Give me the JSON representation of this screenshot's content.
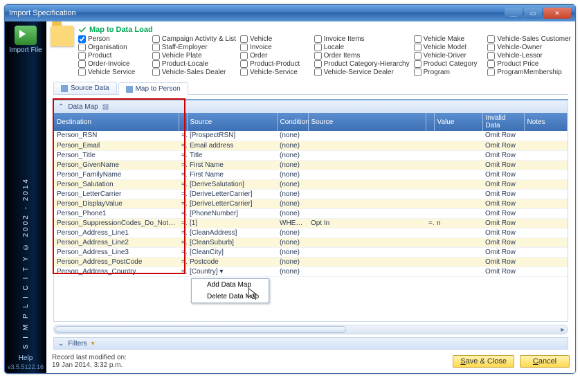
{
  "window": {
    "title": "Import Specification"
  },
  "sidebar": {
    "import_label": "Import File",
    "brand": "S I M P L I C I T Y  ©  2002 - 2014",
    "help": "Help",
    "version": "v3.5.5122.16"
  },
  "checkbox_section": {
    "title": "Map to Data Load",
    "items": [
      {
        "label": "Person",
        "checked": true
      },
      {
        "label": "Campaign Activity & List",
        "checked": false
      },
      {
        "label": "Vehicle",
        "checked": false
      },
      {
        "label": "Invoice Items",
        "checked": false
      },
      {
        "label": "Vehicle Make",
        "checked": false
      },
      {
        "label": "Vehicle-Sales Customer",
        "checked": false
      },
      {
        "label": "Organisation",
        "checked": false
      },
      {
        "label": "Staff-Employer",
        "checked": false
      },
      {
        "label": "Invoice",
        "checked": false
      },
      {
        "label": "Locale",
        "checked": false
      },
      {
        "label": "Vehicle Model",
        "checked": false
      },
      {
        "label": "Vehicle-Owner",
        "checked": false
      },
      {
        "label": "Product",
        "checked": false
      },
      {
        "label": "Vehicle Plate",
        "checked": false
      },
      {
        "label": "Order",
        "checked": false
      },
      {
        "label": "Order Items",
        "checked": false
      },
      {
        "label": "Vehicle-Driver",
        "checked": false
      },
      {
        "label": "Vehicle-Lessor",
        "checked": false
      },
      {
        "label": "Order-Invoice",
        "checked": false
      },
      {
        "label": "Product-Locale",
        "checked": false
      },
      {
        "label": "Product-Product",
        "checked": false
      },
      {
        "label": "Product Category-Hierarchy",
        "checked": false
      },
      {
        "label": "Product Category",
        "checked": false
      },
      {
        "label": "Product Price",
        "checked": false
      },
      {
        "label": "Vehicle Service",
        "checked": false
      },
      {
        "label": "Vehicle-Sales Dealer",
        "checked": false
      },
      {
        "label": "Vehicle-Service",
        "checked": false
      },
      {
        "label": "Vehicle-Service Dealer",
        "checked": false
      },
      {
        "label": "Program",
        "checked": false
      },
      {
        "label": "ProgramMembership",
        "checked": false
      }
    ]
  },
  "tabs": [
    {
      "label": "Source Data",
      "active": false
    },
    {
      "label": "Map to Person",
      "active": true
    }
  ],
  "grid": {
    "panel_title": "Data Map",
    "columns": [
      "Destination",
      "",
      "Source",
      "Condition",
      "Source",
      "",
      "Value",
      "Invalid Data",
      "Notes"
    ],
    "col_widths": [
      "180px",
      "12px",
      "130px",
      "45px",
      "170px",
      "12px",
      "70px",
      "60px",
      "auto"
    ],
    "rows": [
      {
        "dest": "Person_RSN",
        "op": "=",
        "src": "[ProspectRSN]",
        "cond": "(none)",
        "src2": "",
        "op2": "",
        "val": "",
        "inv": "Omit Row",
        "alt": false
      },
      {
        "dest": "Person_Email",
        "op": "=",
        "src": "Email address",
        "cond": "(none)",
        "src2": "",
        "op2": "",
        "val": "",
        "inv": "Omit Row",
        "alt": true
      },
      {
        "dest": "Person_Title",
        "op": "=",
        "src": "Title",
        "cond": "(none)",
        "src2": "",
        "op2": "",
        "val": "",
        "inv": "Omit Row",
        "alt": false
      },
      {
        "dest": "Person_GivenName",
        "op": "=",
        "src": "First Name",
        "cond": "(none)",
        "src2": "",
        "op2": "",
        "val": "",
        "inv": "Omit Row",
        "alt": true
      },
      {
        "dest": "Person_FamilyName",
        "op": "=",
        "src": "First Name",
        "cond": "(none)",
        "src2": "",
        "op2": "",
        "val": "",
        "inv": "Omit Row",
        "alt": false
      },
      {
        "dest": "Person_Salutation",
        "op": "=",
        "src": "[DeriveSalutation]",
        "cond": "(none)",
        "src2": "",
        "op2": "",
        "val": "",
        "inv": "Omit Row",
        "alt": true
      },
      {
        "dest": "Person_LetterCarrier",
        "op": "=",
        "src": "[DeriveLetterCarrier]",
        "cond": "(none)",
        "src2": "",
        "op2": "",
        "val": "",
        "inv": "Omit Row",
        "alt": false
      },
      {
        "dest": "Person_DisplayValue",
        "op": "=",
        "src": "[DeriveLetterCarrier]",
        "cond": "(none)",
        "src2": "",
        "op2": "",
        "val": "",
        "inv": "Omit Row",
        "alt": true
      },
      {
        "dest": "Person_Phone1",
        "op": "=",
        "src": "[PhoneNumber]",
        "cond": "(none)",
        "src2": "",
        "op2": "",
        "val": "",
        "inv": "Omit Row",
        "alt": false
      },
      {
        "dest": "Person_SuppressionCodes_Do_Not_Contact",
        "op": "=",
        "src": "[1]",
        "cond": "WHERE",
        "src2": "Opt In",
        "op2": "=",
        "val": "n",
        "inv": "Omit Row",
        "alt": true
      },
      {
        "dest": "Person_Address_Line1",
        "op": "=",
        "src": "[CleanAddress]",
        "cond": "(none)",
        "src2": "",
        "op2": "",
        "val": "",
        "inv": "Omit Row",
        "alt": false
      },
      {
        "dest": "Person_Address_Line2",
        "op": "=",
        "src": "[CleanSuburb]",
        "cond": "(none)",
        "src2": "",
        "op2": "",
        "val": "",
        "inv": "Omit Row",
        "alt": true
      },
      {
        "dest": "Person_Address_Line3",
        "op": "=",
        "src": "[CleanCity]",
        "cond": "(none)",
        "src2": "",
        "op2": "",
        "val": "",
        "inv": "Omit Row",
        "alt": false
      },
      {
        "dest": "Person_Address_PostCode",
        "op": "=",
        "src": "Postcode",
        "cond": "(none)",
        "src2": "",
        "op2": "",
        "val": "",
        "inv": "Omit Row",
        "alt": true
      },
      {
        "dest": "Person_Address_Country",
        "op": "=",
        "src": "[Country]",
        "cond": "(none)",
        "src2": "",
        "op2": "",
        "val": "",
        "inv": "Omit Row",
        "alt": false,
        "dropdown": true
      }
    ]
  },
  "context_menu": {
    "items": [
      "Add Data Map",
      "Delete Data Map"
    ]
  },
  "filters_label": "Filters",
  "footer": {
    "modified_label": "Record last modified on:",
    "modified_value": "19 Jan 2014, 3:32 p.m.",
    "save": "Save & Close",
    "cancel": "Cancel"
  }
}
